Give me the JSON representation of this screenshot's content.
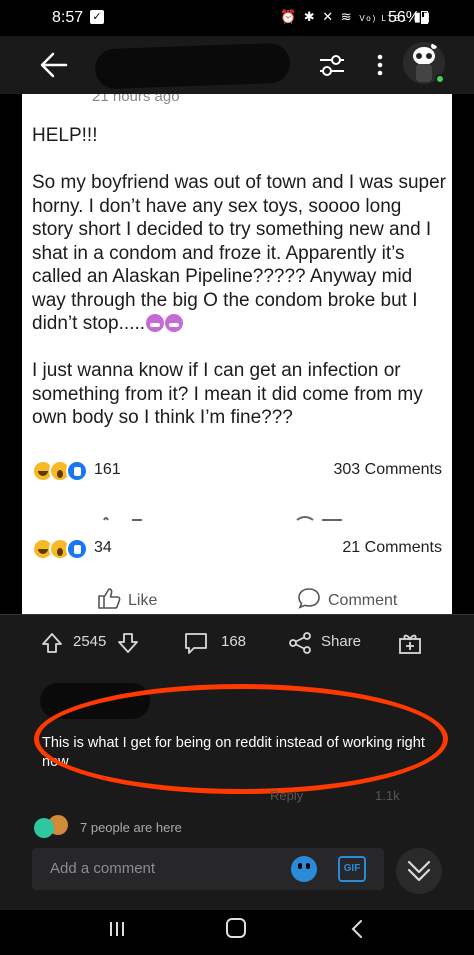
{
  "status_bar": {
    "time": "8:57",
    "battery": "56%",
    "network": "Vo) LTE1"
  },
  "post": {
    "timestamp": "21 hours ago",
    "body": "HELP!!!\n\nSo my boyfriend was out of town and I was super horny. I don’t have any sex toys, soooo long story short I decided to try something new and I shat in a condom and froze it. Apparently it’s called an Alaskan Pipeline????? Anyway mid way through the big O the condom broke but I didn’t stop.....",
    "body2": "\n\nI just wanna know if I can get an infection or something from it? I mean it did come from my own body so I think I’m fine???",
    "reactions_count": "161",
    "comments_count": "303 Comments",
    "reactions_count_2": "34",
    "comments_count_2": "21 Comments",
    "like_label": "Like",
    "comment_label": "Comment"
  },
  "reddit_actions": {
    "score": "2545",
    "comments": "168",
    "share_label": "Share"
  },
  "comment": {
    "text": "This is what I get for being on reddit instead of working right now",
    "reply_label": "Reply",
    "score": "1.1k"
  },
  "presence": {
    "text": "7 people are here"
  },
  "comment_input": {
    "placeholder": "Add a comment",
    "gif_label": "GIF"
  },
  "colors": {
    "annotation": "#ff3a00",
    "accent": "#2a8bd8",
    "online": "#46d160"
  }
}
